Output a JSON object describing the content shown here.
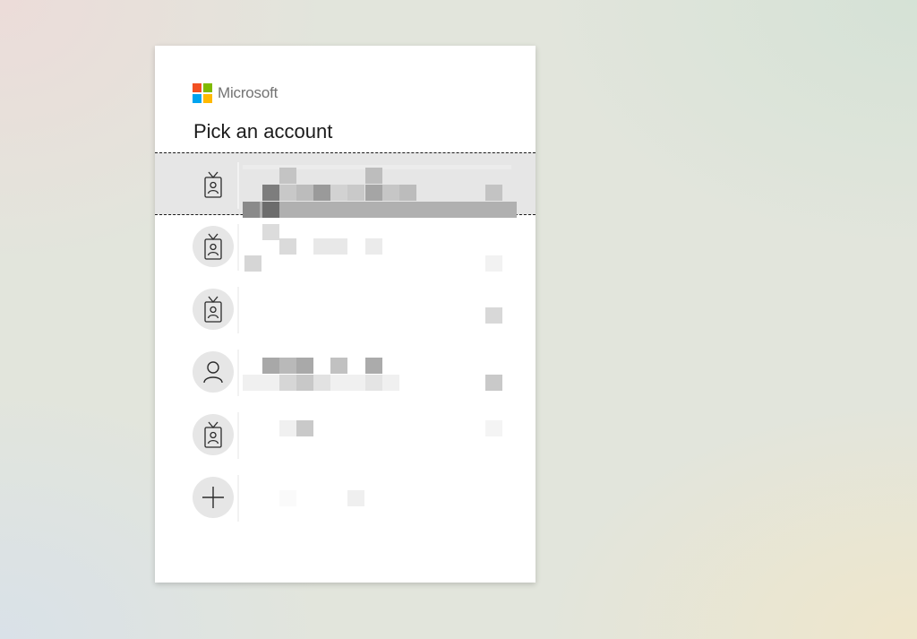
{
  "brand": {
    "name": "Microsoft",
    "logo_colors": [
      "#f25022",
      "#7fba00",
      "#00a4ef",
      "#ffb900"
    ]
  },
  "title": "Pick an account",
  "accounts": [
    {
      "icon": "badge-icon",
      "name": "",
      "email": "",
      "status": "",
      "selected": true
    },
    {
      "icon": "badge-icon",
      "name": "",
      "email": "",
      "status": "",
      "selected": false
    },
    {
      "icon": "badge-icon",
      "name": "",
      "email": "",
      "status": "",
      "selected": false
    },
    {
      "icon": "person-icon",
      "name": "",
      "email": "",
      "status": "",
      "selected": false
    },
    {
      "icon": "badge-icon",
      "name": "",
      "email": "",
      "status": "",
      "selected": false
    }
  ],
  "add_account": {
    "icon": "plus-icon",
    "label": ""
  },
  "colors": {
    "selected_row": "#e6e6e6",
    "avatar_bg": "#e6e6e6",
    "title_text": "#1b1b1b",
    "brand_text": "#737373"
  }
}
